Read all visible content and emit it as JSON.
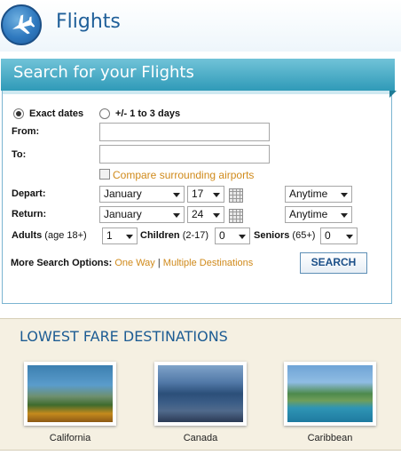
{
  "header": {
    "title": "Flights",
    "logo_icon": "airplane-icon"
  },
  "search": {
    "heading": "Search for your Flights",
    "radio_exact": "Exact dates",
    "radio_flex": "+/- 1 to 3 days",
    "from_label": "From:",
    "to_label": "To:",
    "compare_label": "Compare surrounding airports",
    "depart_label": "Depart:",
    "return_label": "Return:",
    "depart_month": "January",
    "depart_day": "17",
    "depart_time": "Anytime",
    "return_month": "January",
    "return_day": "24",
    "return_time": "Anytime",
    "adults_label": "Adults",
    "adults_age": "(age 18+)",
    "adults_value": "1",
    "children_label": "Children",
    "children_age": "(2-17)",
    "children_value": "0",
    "seniors_label": "Seniors",
    "seniors_age": "(65+)",
    "seniors_value": "0",
    "more_options": "More Search Options:",
    "one_way": "One Way",
    "multiple": "Multiple Destinations",
    "search_button": "SEARCH"
  },
  "lowest": {
    "title": "LOWEST FARE DESTINATIONS",
    "destinations": [
      {
        "name": "California"
      },
      {
        "name": "Canada"
      },
      {
        "name": "Caribbean"
      }
    ]
  },
  "colors": {
    "header_blue": "#1f5f99",
    "panel_head": "#2f9ab8",
    "link_orange": "#d08a1b",
    "lowest_bg": "#f5f0e2"
  }
}
